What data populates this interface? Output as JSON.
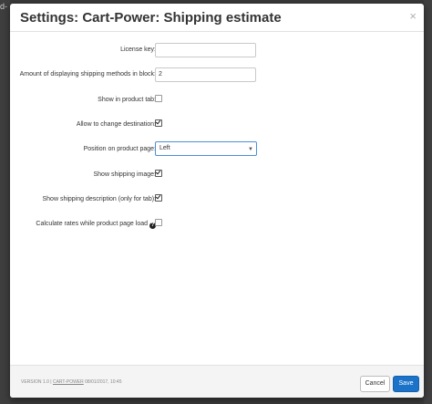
{
  "dialog": {
    "title": "Settings: Cart-Power: Shipping estimate",
    "close_glyph": "×"
  },
  "background": {
    "fragment": "d-"
  },
  "form": {
    "license_key": {
      "label": "License key:",
      "value": ""
    },
    "methods_count": {
      "label": "Amount of displaying shipping methods in block:",
      "value": "2"
    },
    "show_in_product_tab": {
      "label": "Show in product tab:",
      "checked": false
    },
    "allow_change_destination": {
      "label": "Allow to change destination:",
      "checked": true
    },
    "position": {
      "label": "Position on product page:",
      "selected": "Left"
    },
    "show_shipping_image": {
      "label": "Show shipping image:",
      "checked": true
    },
    "show_shipping_description": {
      "label": "Show shipping description (only for tab):",
      "checked": true
    },
    "calculate_rates": {
      "label": "Calculate rates while product page load",
      "help_glyph": "?",
      "checked": false
    }
  },
  "footer": {
    "version": "VERSION 1.0",
    "separator": "|",
    "vendor": "CART-POWER",
    "date": "08/01/2017, 10:45",
    "cancel_label": "Cancel",
    "save_label": "Save"
  }
}
